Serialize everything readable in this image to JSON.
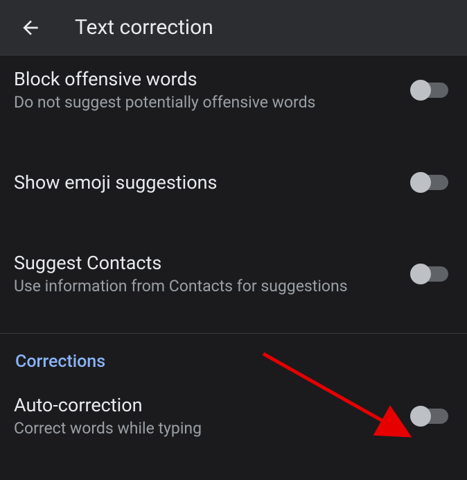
{
  "header": {
    "title": "Text correction"
  },
  "section1": {
    "items": [
      {
        "title": "Block offensive words",
        "sub": "Do not suggest potentially offensive words"
      },
      {
        "title": "Show emoji suggestions",
        "sub": ""
      },
      {
        "title": "Suggest Contacts",
        "sub": "Use information from Contacts for suggestions"
      }
    ]
  },
  "section2": {
    "header": "Corrections",
    "items": [
      {
        "title": "Auto-correction",
        "sub": "Correct words while typing"
      }
    ]
  }
}
